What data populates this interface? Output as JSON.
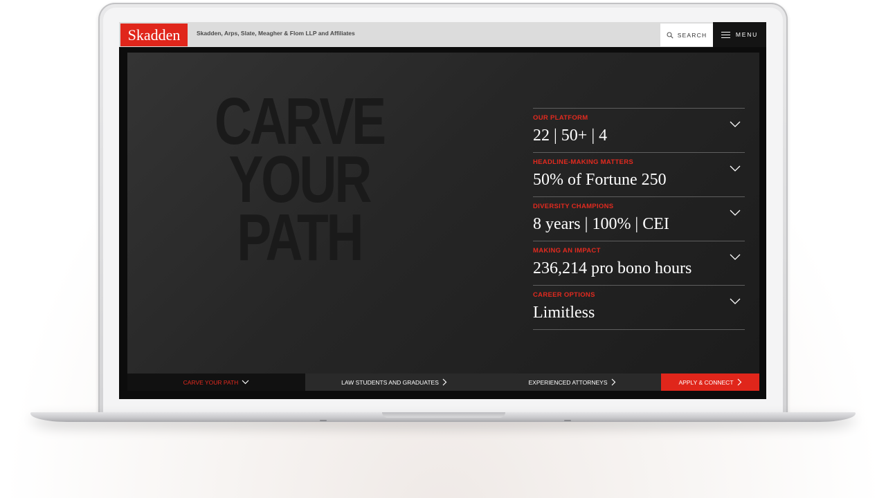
{
  "header": {
    "logo": "Skadden",
    "firm_name": "Skadden, Arps, Slate, Meagher & Flom LLP and Affiliates",
    "search_label": "SEARCH",
    "menu_label": "MENU"
  },
  "hero": {
    "headline_line1": "CARVE",
    "headline_line2": "YOUR",
    "headline_line3": "PATH"
  },
  "stats": [
    {
      "label": "OUR PLATFORM",
      "value": "22 | 50+ | 4"
    },
    {
      "label": "HEADLINE-MAKING MATTERS",
      "value": "50% of Fortune 250"
    },
    {
      "label": "DIVERSITY CHAMPIONS",
      "value": "8 years | 100% | CEI"
    },
    {
      "label": "MAKING AN IMPACT",
      "value": "236,214 pro bono hours"
    },
    {
      "label": "CAREER OPTIONS",
      "value": "Limitless"
    }
  ],
  "bottom_nav": [
    {
      "label": "CARVE YOUR PATH",
      "icon": "chevron-down-icon",
      "active": true
    },
    {
      "label": "LAW STUDENTS AND GRADUATES",
      "icon": "chevron-right-icon"
    },
    {
      "label": "EXPERIENCED ATTORNEYS",
      "icon": "chevron-right-icon"
    },
    {
      "label": "APPLY & CONNECT",
      "icon": "chevron-right-icon"
    }
  ],
  "colors": {
    "accent": "#e0261b",
    "dark": "#141414"
  }
}
